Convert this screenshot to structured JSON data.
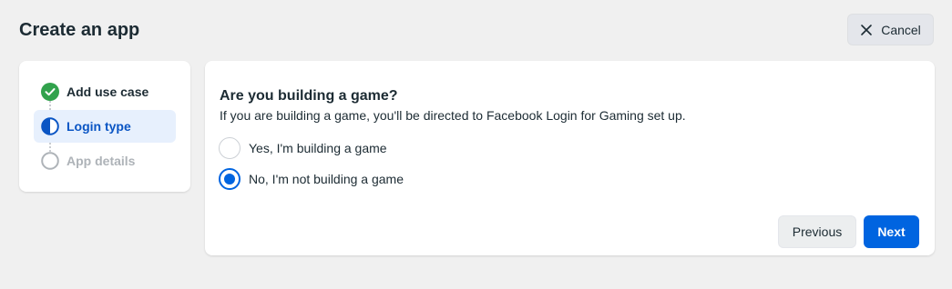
{
  "header": {
    "title": "Create an app",
    "cancel_label": "Cancel"
  },
  "steps": [
    {
      "label": "Add use case",
      "status": "completed",
      "icon": "check-circle-icon"
    },
    {
      "label": "Login type",
      "status": "current",
      "icon": "half-circle-icon"
    },
    {
      "label": "App details",
      "status": "upcoming",
      "icon": "empty-circle-icon"
    }
  ],
  "form": {
    "question": "Are you building a game?",
    "description": "If you are building a game, you'll be directed to Facebook Login for Gaming set up.",
    "options": [
      {
        "label": "Yes, I'm building a game",
        "selected": false
      },
      {
        "label": "No, I'm not building a game",
        "selected": true
      }
    ]
  },
  "footer": {
    "previous_label": "Previous",
    "next_label": "Next"
  },
  "colors": {
    "accent": "#0064e0",
    "success": "#31a24c",
    "current_step_bg": "#e7f0fd",
    "current_step_text": "#0a55c4"
  }
}
